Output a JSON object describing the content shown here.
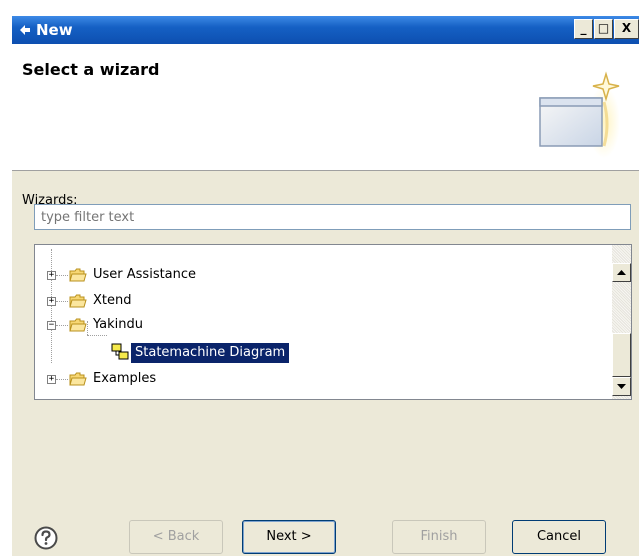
{
  "window": {
    "title": "New",
    "buttons": {
      "minimize": "_",
      "maximize": "□",
      "close": "X"
    }
  },
  "header": {
    "title": "Select a wizard"
  },
  "wizards": {
    "label": "Wizards:",
    "filter_placeholder": "type filter text"
  },
  "tree": {
    "items": [
      {
        "label": "User Assistance",
        "expander": "+",
        "icon": "folder-icon"
      },
      {
        "label": "Xtend",
        "expander": "+",
        "icon": "folder-icon"
      },
      {
        "label": "Yakindu",
        "expander": "−",
        "icon": "folder-open-icon"
      },
      {
        "label": "Statemachine Diagram",
        "icon": "statechart-icon",
        "selected": true
      },
      {
        "label": "Examples",
        "expander": "+",
        "icon": "folder-icon"
      }
    ]
  },
  "buttons": {
    "back": "< Back",
    "next": "Next >",
    "finish": "Finish",
    "cancel": "Cancel"
  },
  "colors": {
    "titlebar": "#1560c4",
    "selection": "#0a246a",
    "dialog_bg": "#ece9d8",
    "folder": "#f2c94c"
  }
}
